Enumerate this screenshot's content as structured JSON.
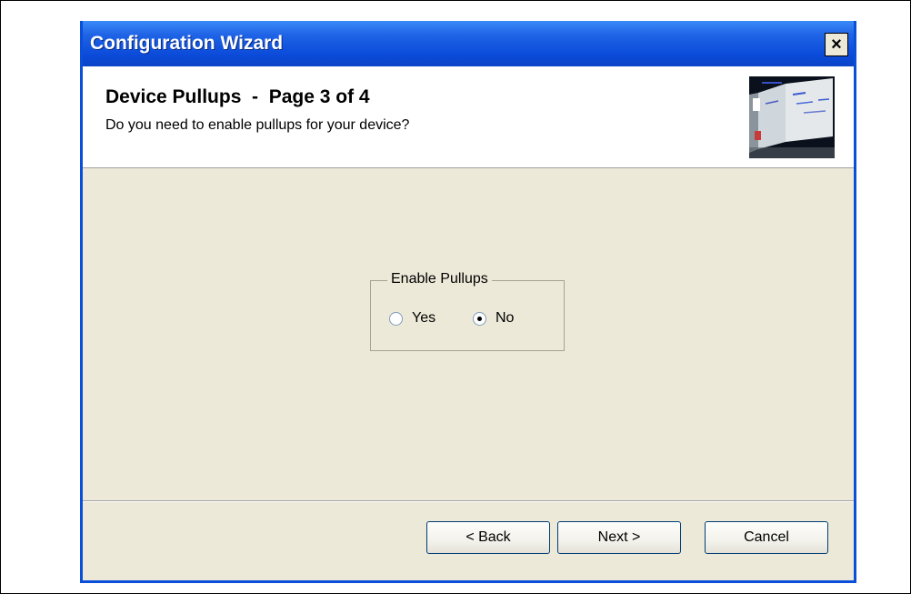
{
  "window": {
    "title": "Configuration Wizard",
    "close_symbol": "×"
  },
  "header": {
    "title": "Device Pullups  -  Page 3 of 4",
    "subtitle": "Do you need to enable pullups for your device?",
    "image_icon": "wizard-header-image"
  },
  "pullups": {
    "group_label": "Enable Pullups",
    "options": [
      {
        "label": "Yes",
        "selected": false
      },
      {
        "label": "No",
        "selected": true
      }
    ]
  },
  "buttons": {
    "back": "< Back",
    "next": "Next >",
    "cancel": "Cancel"
  },
  "colors": {
    "titlebar": "#0b4bd9",
    "dialog_bg": "#ece9d8",
    "border": "#0a4fd8"
  }
}
